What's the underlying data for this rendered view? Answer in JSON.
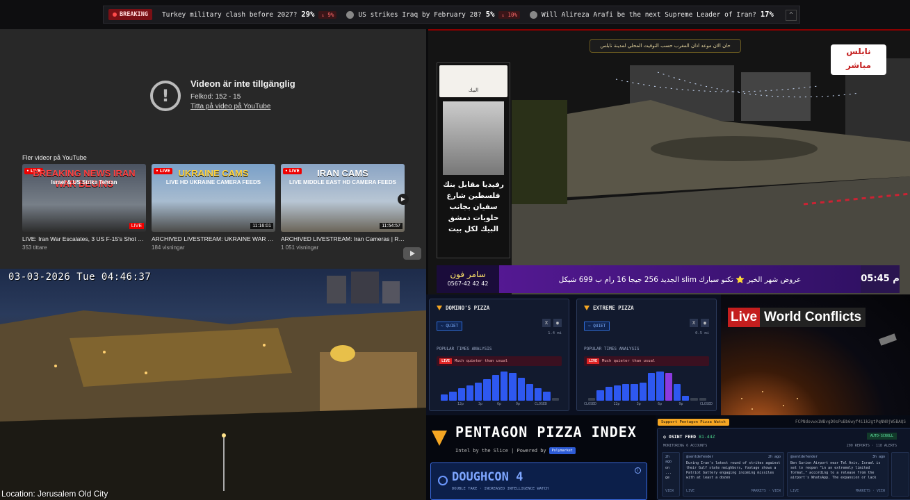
{
  "ticker": {
    "breaking_label": "BREAKING",
    "markets": [
      {
        "question": "Turkey military clash before 2027?",
        "pct": "29%",
        "change": "↓ 9%"
      },
      {
        "question": "US strikes Iraq by February 28?",
        "pct": "5%",
        "change": "↓ 10%"
      },
      {
        "question": "Will Alireza Arafi be the next Supreme Leader of Iran?",
        "pct": "17%"
      }
    ],
    "collapse_glyph": "^"
  },
  "youtube": {
    "error_title": "Videon är inte tillgänglig",
    "error_code": "Felkod: 152 - 15",
    "error_link": "Titta på video på YouTube",
    "more_videos_label": "Fler videor på YouTube",
    "videos": [
      {
        "thumb_head": "BREAKING NEWS IRAN WAR BEGINS",
        "thumb_sub": "Israel & US Strike Tehran",
        "badge": "LIVE",
        "title": "LIVE: Iran War Escalates, 3 US F-15's Shot D...",
        "meta": "353 tittare"
      },
      {
        "thumb_head": "UKRAINE CAMS",
        "thumb_sub": "LIVE HD UKRAINE CAMERA FEEDS",
        "badge": "11:16:01",
        "title": "ARCHIVED LIVESTREAM: UKRAINE WAR C...",
        "meta": "184 visningar"
      },
      {
        "thumb_head": "IRAN CAMS",
        "thumb_sub": "LIVE MIDDLE EAST HD CAMERA FEEDS",
        "badge": "11:54:57",
        "title": "ARCHIVED LIVESTREAM: Iran Cameras | Re...",
        "meta": "1 051 visningar"
      }
    ]
  },
  "jerusalem": {
    "timestamp": "03-03-2026 Tue 04:46:37",
    "location": "Location: Jerusalem Old City"
  },
  "nablus": {
    "logo_line1": "نابلس",
    "logo_line2": "مباشر",
    "top_caption": "حان الان موعد اذان المغرب حسب التوقيت المحلي لمدينة نابلس",
    "ad_brand": "البيك",
    "ad_text": "رفيديا مقابل بنك فلسطين شارع سفيان بجانب حلويات دمشق البيك لكل بيت",
    "ticker_time": "05:45 م",
    "ticker_msg": "عروض شهر الخير ⭐ تكنو سبارك slim الجديد 256 جيجا 16 رام ب 699 شيكل",
    "ticker_brand": "سامر فون",
    "ticker_phone": "0567-42 42 42"
  },
  "pizza": {
    "cards": [
      {
        "name": "DOMINO'S PIZZA",
        "status": "~ QUIET",
        "distance": "1.4 mi",
        "section": "POPULAR TIMES ANALYSIS",
        "live": "LIVE",
        "live_text": "Much quieter than usual",
        "bars": [
          0.2,
          0.3,
          0.4,
          0.5,
          0.6,
          0.7,
          0.85,
          0.95,
          0.9,
          0.75,
          0.55,
          0.4,
          0.3,
          0.1
        ],
        "now_index": -1,
        "xlabels": [
          "12p",
          "3p",
          "6p",
          "9p",
          "CLOSED"
        ]
      },
      {
        "name": "EXTREME PIZZA",
        "status": "~ QUIET",
        "distance": "0.5 mi",
        "section": "POPULAR TIMES ANALYSIS",
        "live": "LIVE",
        "live_text": "Much quieter than usual",
        "bars": [
          0.1,
          0.35,
          0.45,
          0.5,
          0.55,
          0.55,
          0.6,
          0.9,
          0.95,
          0.9,
          0.55,
          0.15,
          0.1,
          0.1
        ],
        "now_index": 9,
        "xlabels": [
          "CLOSED",
          "12p",
          "3p",
          "6p",
          "9p",
          "CLOSED"
        ]
      }
    ]
  },
  "conflicts": {
    "live": "Live",
    "rest": "World Conflicts"
  },
  "ppi": {
    "title": "PENTAGON PIZZA INDEX",
    "tagline": "Intel by the Slice | Powered by",
    "powered": "Polymarket",
    "level": "DOUGHCON 4",
    "level_sub": "DOUBLE TAKE · INCREASED INTELLIGENCE WATCH"
  },
  "osint": {
    "support": "Support Pentagon Pizza Watch",
    "address": "FCPNdovwx1WBvgD0sPuBb6wyf4i1k2gtPqNN0jW5BAQS",
    "title": "OSINT FEED",
    "count": "81-44Z",
    "auto": "AUTO-SCROLL",
    "monitoring": "MONITORING 6 ACCOUNTS",
    "reports": "200 REPORTS · 118 ALERTS",
    "posts": [
      {
        "who": "",
        "age": "2h ago",
        "text": "on ... ge",
        "foot": "VIEW"
      },
      {
        "who": "@sentdefender",
        "age": "2h ago",
        "text": "During Iran's latest round of strikes against their Gulf state neighbors, footage shows a Patriot battery engaging incoming missiles with at least a dozen",
        "foot_l": "LIVE",
        "foot_r": "MARKETS · VIEW"
      },
      {
        "who": "@sentdefender",
        "age": "3h ago",
        "text": "Ben Gurion Airport near Tel Aviv, Israel is set to reopen \"in an extremely limited format,\" according to a release from the airport's WhatsApp. The expansion or lack",
        "foot_l": "LIVE",
        "foot_r": "MARKETS · VIEW"
      },
      {
        "who": "",
        "age": "",
        "text": "",
        "foot": ""
      }
    ]
  }
}
